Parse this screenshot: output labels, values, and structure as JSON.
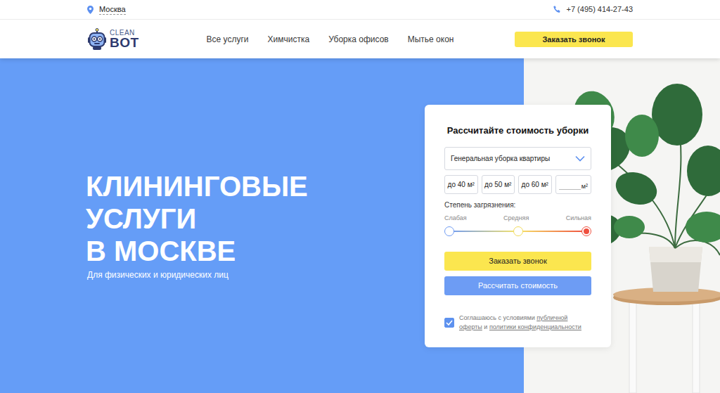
{
  "top_bar": {
    "city": "Москва",
    "phone": "+7 (495) 414-27-43"
  },
  "logo": {
    "line1": "CLEAN",
    "line2": "BOT"
  },
  "nav": {
    "items": [
      "Все услуги",
      "Химчистка",
      "Уборка офисов",
      "Мытье окон"
    ],
    "cta": "Заказать звонок"
  },
  "hero": {
    "title_lines": [
      "КЛИНИНГОВЫЕ",
      "УСЛУГИ",
      "В МОСКВЕ"
    ],
    "subtitle": "Для физических и юридических лиц"
  },
  "calculator": {
    "title": "Рассчитайте стоимость уборки",
    "service": "Генеральная уборка квартиры",
    "areas": [
      {
        "label": "до 40 м²",
        "selected": false
      },
      {
        "label": "до 50 м²",
        "selected": false
      },
      {
        "label": "до 60 м²",
        "selected": false
      }
    ],
    "custom_area": {
      "unit": "м²"
    },
    "dirt": {
      "label": "Степень загрязнения:",
      "level": 1,
      "levels": [
        {
          "label": "Слабая",
          "color": "#6f9bf3",
          "selected": false
        },
        {
          "label": "Средняя",
          "color": "#f2dc5a",
          "selected": false
        },
        {
          "label": "Сильная",
          "color": "#ef4f3e",
          "selected": true
        }
      ]
    },
    "call_button": "Заказать звонок",
    "calc_button": "Рассчитать стоимость",
    "agree": {
      "checked": true,
      "text": "Соглашаюсь с условиями",
      "offer_link": "публичной оферты",
      "and": "и",
      "privacy_link": "политики конфиденциальности"
    }
  }
}
